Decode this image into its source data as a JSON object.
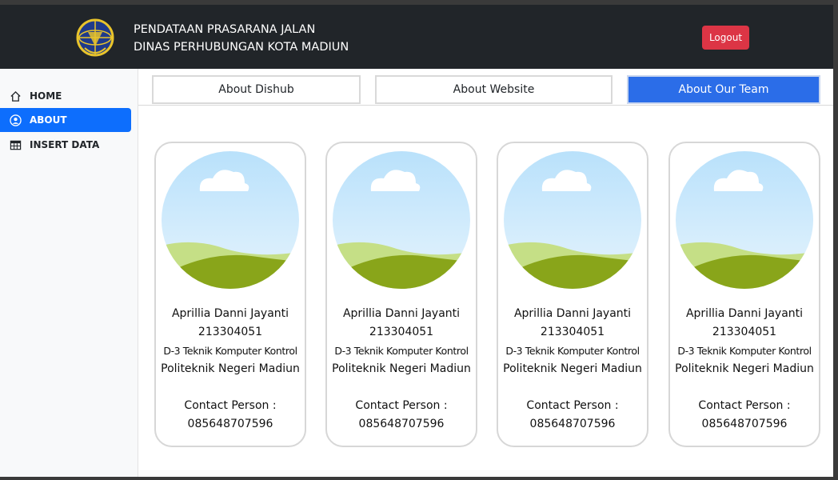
{
  "header": {
    "brand_line1": "PENDATAAN PRASARANA JALAN",
    "brand_line2": "DINAS PERHUBUNGAN KOTA MADIUN",
    "logout_label": "Logout"
  },
  "sidebar": {
    "items": [
      {
        "label": "HOME",
        "icon": "home-icon",
        "active": false
      },
      {
        "label": "ABOUT",
        "icon": "user-circle-icon",
        "active": true
      },
      {
        "label": "INSERT DATA",
        "icon": "table-icon",
        "active": false
      }
    ]
  },
  "tabs": [
    {
      "label": "About Dishub",
      "active": false
    },
    {
      "label": "About Website",
      "active": false
    },
    {
      "label": "About Our Team",
      "active": true
    }
  ],
  "team": [
    {
      "name": "Aprillia Danni Jayanti",
      "nim": "213304051",
      "prodi": "D-3 Teknik Komputer Kontrol",
      "campus": "Politeknik Negeri Madiun",
      "contact_label": "Contact Person :",
      "phone": "085648707596"
    },
    {
      "name": "Aprillia Danni Jayanti",
      "nim": "213304051",
      "prodi": "D-3 Teknik Komputer Kontrol",
      "campus": "Politeknik Negeri Madiun",
      "contact_label": "Contact Person :",
      "phone": "085648707596"
    },
    {
      "name": "Aprillia Danni Jayanti",
      "nim": "213304051",
      "prodi": "D-3 Teknik Komputer Kontrol",
      "campus": "Politeknik Negeri Madiun",
      "contact_label": "Contact Person :",
      "phone": "085648707596"
    },
    {
      "name": "Aprillia Danni Jayanti",
      "nim": "213304051",
      "prodi": "D-3 Teknik Komputer Kontrol",
      "campus": "Politeknik Negeri Madiun",
      "contact_label": "Contact Person :",
      "phone": "085648707596"
    }
  ],
  "colors": {
    "header_bg": "#212529",
    "accent": "#0d6efd",
    "tab_active": "#2b6de8",
    "logout": "#dc3545"
  }
}
